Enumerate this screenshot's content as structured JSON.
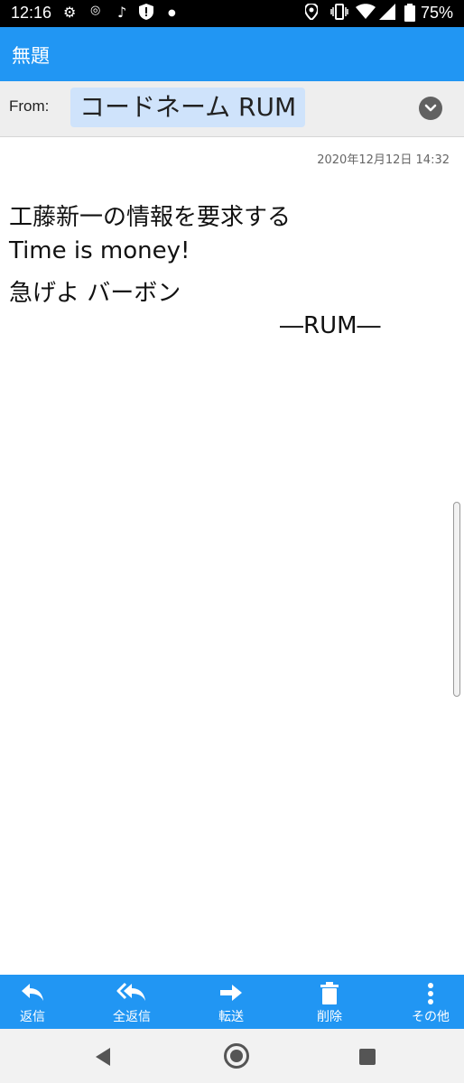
{
  "status_bar": {
    "time": "12:16",
    "battery": "75%"
  },
  "header": {
    "title": "無題"
  },
  "from": {
    "label": "From:",
    "sender": "コードネーム RUM"
  },
  "message": {
    "date": "2020年12月12日 14:32",
    "lines": [
      "工藤新一の情報を要求する",
      "Time is money!",
      "急げよ バーボン"
    ],
    "signature": "―RUM―"
  },
  "toolbar": {
    "reply": "返信",
    "reply_all": "全返信",
    "forward": "転送",
    "delete": "削除",
    "more": "その他"
  },
  "colors": {
    "accent": "#2196f3",
    "chip": "#cfe3fb"
  }
}
